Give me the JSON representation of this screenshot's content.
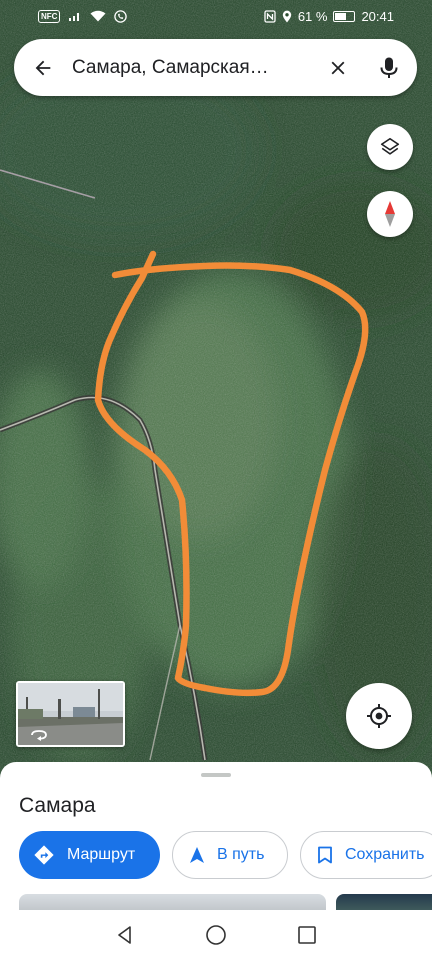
{
  "status_bar": {
    "nfc_badge": "NFC",
    "battery_percent": "61 %",
    "battery_level": 0.61,
    "time": "20:41",
    "icons": [
      "sim-icon",
      "wifi-icon",
      "call-icon",
      "nfc-icon",
      "location-icon",
      "battery-icon"
    ]
  },
  "search": {
    "query": "Самара, Самарская…",
    "icons": {
      "back": "arrow-back-icon",
      "clear": "close-icon",
      "voice": "mic-icon"
    }
  },
  "map": {
    "controls": [
      "layers-icon",
      "compass-icon",
      "my-location-icon",
      "streetview-rotate-icon"
    ],
    "colors": {
      "outline": "#f28c38",
      "satellite_green": "#2f5a34"
    }
  },
  "place_sheet": {
    "title": "Самара",
    "actions": [
      {
        "label": "Маршрут",
        "icon": "directions-icon",
        "primary": true
      },
      {
        "label": "В путь",
        "icon": "navigation-icon",
        "primary": false
      },
      {
        "label": "Сохранить",
        "icon": "bookmark-icon",
        "primary": false
      }
    ],
    "accent": "#1a73e8"
  },
  "navigation_bar": {
    "icons": [
      "back-triangle-icon",
      "home-circle-icon",
      "recents-square-icon"
    ]
  }
}
